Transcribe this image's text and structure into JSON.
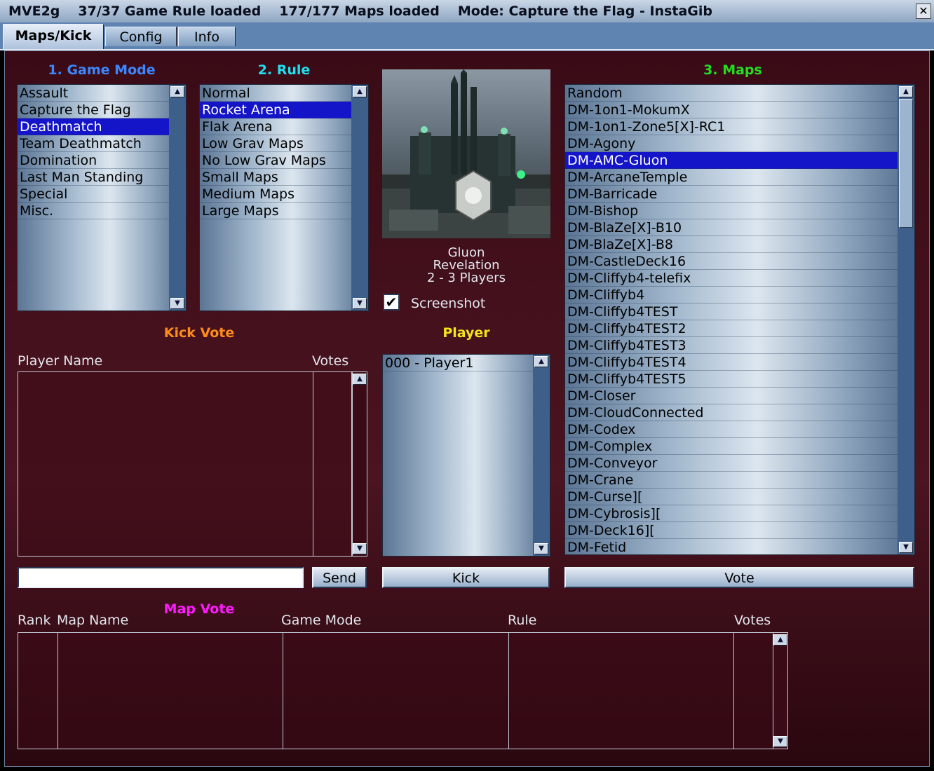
{
  "title": {
    "app": "MVE2g",
    "rules_loaded": "37/37 Game Rule loaded",
    "maps_loaded": "177/177 Maps loaded",
    "mode": "Mode: Capture the Flag - InstaGib",
    "close": "✕"
  },
  "tabs": [
    "Maps/Kick",
    "Config",
    "Info"
  ],
  "game_mode": {
    "heading": "1. Game Mode",
    "heading_color": "#3c86ff",
    "items": [
      "Assault",
      "Capture the Flag",
      "Deathmatch",
      "Team Deathmatch",
      "Domination",
      "Last Man Standing",
      "Special",
      "Misc."
    ],
    "selected": "Deathmatch"
  },
  "rule": {
    "heading": "2. Rule",
    "heading_color": "#1fe0f0",
    "items": [
      "Normal",
      "Rocket Arena",
      "Flak Arena",
      "Low Grav Maps",
      "No Low Grav Maps",
      "Small Maps",
      "Medium Maps",
      "Large Maps"
    ],
    "selected": "Rocket Arena"
  },
  "preview": {
    "map_title": "Gluon",
    "author": "Revelation",
    "players": "2 - 3 Players",
    "screenshot_label": "Screenshot",
    "screenshot_checked": true
  },
  "maps": {
    "heading": "3. Maps",
    "heading_color": "#22dd22",
    "items": [
      "Random",
      "DM-1on1-MokumX",
      "DM-1on1-Zone5[X]-RC1",
      "DM-Agony",
      "DM-AMC-Gluon",
      "DM-ArcaneTemple",
      "DM-Barricade",
      "DM-Bishop",
      "DM-BlaZe[X]-B10",
      "DM-BlaZe[X]-B8",
      "DM-CastleDeck16",
      "DM-Cliffyb4-telefix",
      "DM-Cliffyb4",
      "DM-Cliffyb4TEST",
      "DM-Cliffyb4TEST2",
      "DM-Cliffyb4TEST3",
      "DM-Cliffyb4TEST4",
      "DM-Cliffyb4TEST5",
      "DM-Closer",
      "DM-CloudConnected",
      "DM-Codex",
      "DM-Complex",
      "DM-Conveyor",
      "DM-Crane",
      "DM-Curse][",
      "DM-Cybrosis][",
      "DM-Deck16][",
      "DM-Fetid"
    ],
    "selected": "DM-AMC-Gluon",
    "vote_label": "Vote"
  },
  "kick_vote": {
    "heading": "Kick Vote",
    "heading_color": "#ff8c1a",
    "col_player": "Player Name",
    "col_votes": "Votes",
    "input_value": "",
    "send_label": "Send"
  },
  "player": {
    "heading": "Player",
    "heading_color": "#f5e51a",
    "items": [
      "000 - Player1"
    ],
    "kick_label": "Kick"
  },
  "map_vote": {
    "heading": "Map Vote",
    "heading_color": "#ff1aff",
    "columns": [
      "Rank",
      "Map Name",
      "Game Mode",
      "Rule",
      "Votes"
    ]
  }
}
